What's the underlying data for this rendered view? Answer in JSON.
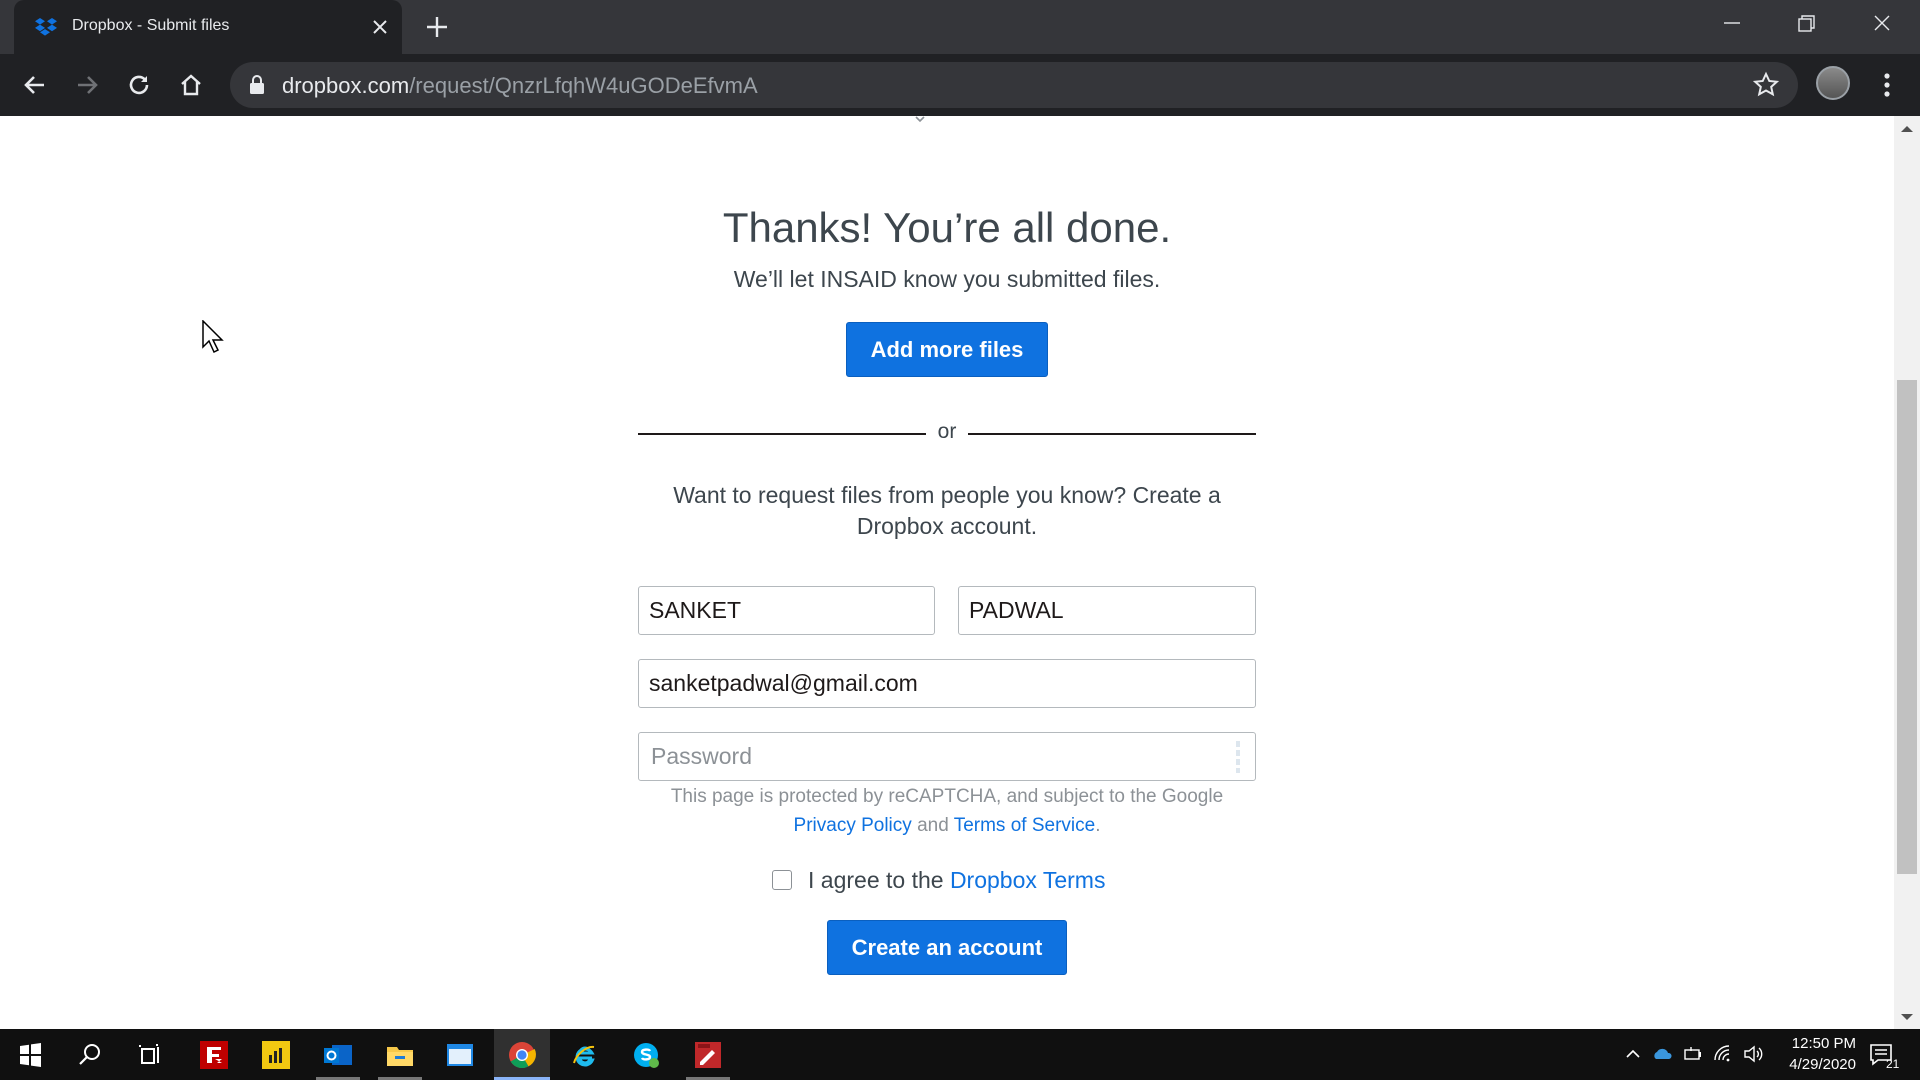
{
  "browser": {
    "tab_title": "Dropbox - Submit files",
    "url_host": "dropbox.com",
    "url_path": "/request/QnzrLfqhW4uGODeEfvmA"
  },
  "page": {
    "heading": "Thanks! You’re all done.",
    "subheading": "We’ll let INSAID know you submitted files.",
    "add_more_label": "Add more files",
    "divider_text": "or",
    "request_text": "Want to request files from people you know? Create a Dropbox account.",
    "form": {
      "first_name_value": "SANKET",
      "last_name_value": "PADWAL",
      "email_value": "sanketpadwal@gmail.com",
      "password_placeholder": "Password"
    },
    "recaptcha": {
      "prefix": "This page is protected by reCAPTCHA, and subject to the Google",
      "privacy_link": "Privacy Policy",
      "and_text": "and",
      "terms_link": "Terms of Service",
      "suffix": "."
    },
    "agree": {
      "text": "I agree to the",
      "link": "Dropbox Terms",
      "checked": false
    },
    "create_account_label": "Create an account"
  },
  "taskbar": {
    "time": "12:50 PM",
    "date": "4/29/2020",
    "notification_count": "21",
    "apps": [
      "filezilla-icon",
      "power-bi-icon",
      "outlook-icon",
      "file-explorer-icon",
      "window-app-icon",
      "chrome-icon",
      "internet-explorer-icon",
      "skype-icon",
      "pdf-editor-icon"
    ]
  },
  "colors": {
    "accent": "#0f72e0",
    "text": "#3d464d",
    "muted": "#8c9196",
    "chrome_dark": "#202124"
  }
}
